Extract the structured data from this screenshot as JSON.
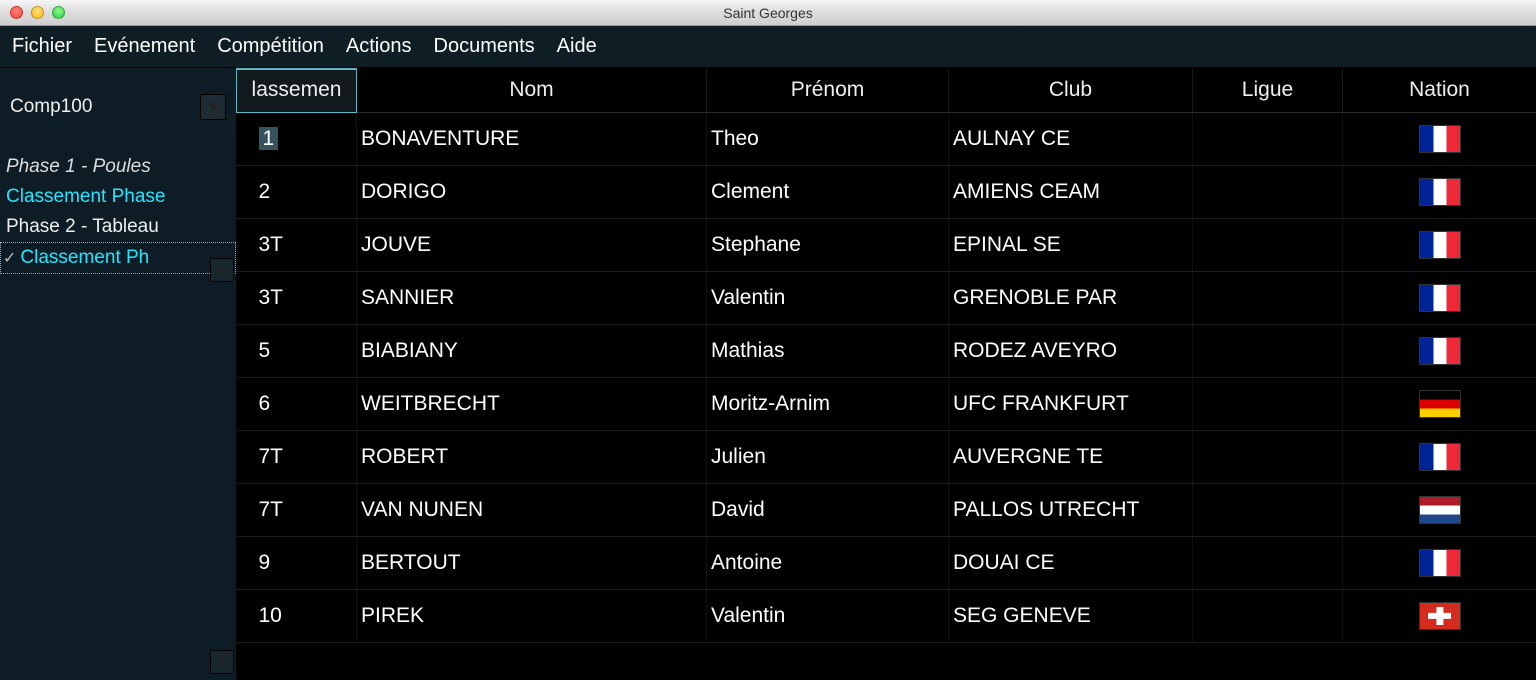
{
  "window": {
    "title": "Saint Georges"
  },
  "menubar": {
    "items": [
      "Fichier",
      "Evénement",
      "Compétition",
      "Actions",
      "Documents",
      "Aide"
    ]
  },
  "sidebar": {
    "combo_value": "Comp100",
    "phases": [
      {
        "label": "Phase 1 - Poules",
        "style": "italic"
      },
      {
        "label": "Classement Phase",
        "style": "cyan"
      },
      {
        "label": "Phase 2 - Tableau",
        "style": "plain"
      },
      {
        "label": "Classement Ph",
        "style": "checked"
      }
    ]
  },
  "table": {
    "headers": {
      "rank": "lassemen",
      "nom": "Nom",
      "prenom": "Prénom",
      "club": "Club",
      "ligue": "Ligue",
      "nation": "Nation"
    },
    "rows": [
      {
        "rank": "1",
        "nom": "BONAVENTURE",
        "prenom": "Theo",
        "club": "AULNAY CE",
        "ligue": "",
        "nation": "fr"
      },
      {
        "rank": "2",
        "nom": "DORIGO",
        "prenom": "Clement",
        "club": "AMIENS CEAM",
        "ligue": "",
        "nation": "fr"
      },
      {
        "rank": "3T",
        "nom": "JOUVE",
        "prenom": "Stephane",
        "club": "EPINAL SE",
        "ligue": "",
        "nation": "fr"
      },
      {
        "rank": "3T",
        "nom": "SANNIER",
        "prenom": "Valentin",
        "club": "GRENOBLE PAR",
        "ligue": "",
        "nation": "fr"
      },
      {
        "rank": "5",
        "nom": "BIABIANY",
        "prenom": "Mathias",
        "club": "RODEZ AVEYRO",
        "ligue": "",
        "nation": "fr"
      },
      {
        "rank": "6",
        "nom": "WEITBRECHT",
        "prenom": "Moritz-Arnim",
        "club": "UFC FRANKFURT",
        "ligue": "",
        "nation": "de"
      },
      {
        "rank": "7T",
        "nom": "ROBERT",
        "prenom": "Julien",
        "club": "AUVERGNE TE",
        "ligue": "",
        "nation": "fr"
      },
      {
        "rank": "7T",
        "nom": "VAN NUNEN",
        "prenom": "David",
        "club": "PALLOS UTRECHT",
        "ligue": "",
        "nation": "nl"
      },
      {
        "rank": "9",
        "nom": "BERTOUT",
        "prenom": "Antoine",
        "club": "DOUAI CE",
        "ligue": "",
        "nation": "fr"
      },
      {
        "rank": "10",
        "nom": "PIREK",
        "prenom": "Valentin",
        "club": "SEG GENEVE",
        "ligue": "",
        "nation": "ch"
      }
    ]
  }
}
